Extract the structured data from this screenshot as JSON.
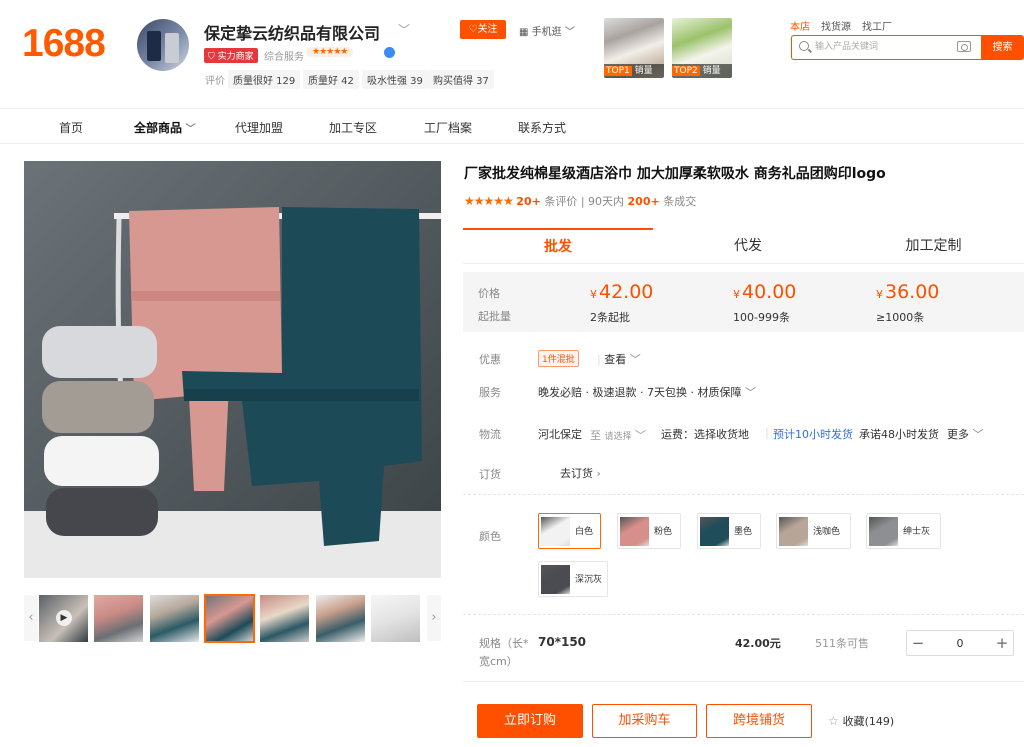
{
  "header": {
    "logo": "1688",
    "shop_name": "保定挚云纺织品有限公司",
    "badge_strength": "实力商家",
    "service_label": "综合服务",
    "service_stars": "★★★★★",
    "follow": "关注",
    "mobile_shop": "手机逛",
    "tags_label": "评价",
    "tags": [
      "质量很好 129",
      "质量好 42",
      "吸水性强 39",
      "购买值得 37"
    ],
    "top_images": [
      {
        "rank": "TOP1",
        "label": "销量"
      },
      {
        "rank": "TOP2",
        "label": "销量"
      }
    ],
    "top_links": [
      "本店",
      "找货源",
      "找工厂"
    ],
    "search_placeholder": "输入产品关键词",
    "search_button": "搜索"
  },
  "nav": {
    "items": [
      "首页",
      "全部商品",
      "代理加盟",
      "加工专区",
      "工厂档案",
      "联系方式"
    ],
    "active_index": 1
  },
  "product": {
    "title": "厂家批发纯棉星级酒店浴巾 加大加厚柔软吸水 商务礼品团购印logo",
    "rating_stars": "★★★★★",
    "reviews_count": "20+",
    "reviews_label": "条评价",
    "sold_prefix": "90天内",
    "sold_count": "200+",
    "sold_label": "条成交",
    "tabs": [
      "批发",
      "代发",
      "加工定制"
    ],
    "active_tab": 0
  },
  "pricing": {
    "price_label": "价格",
    "qty_label": "起批量",
    "currency": "¥",
    "tiers": [
      {
        "price": "42.00",
        "qty": "2条起批"
      },
      {
        "price": "40.00",
        "qty": "100-999条"
      },
      {
        "price": "36.00",
        "qty": "≥1000条"
      }
    ]
  },
  "offers": {
    "coupon_label": "优惠",
    "coupon_chip": "1件混批",
    "coupon_view": "查看",
    "service_label": "服务",
    "service_text": "晚发必赔 · 极速退款 · 7天包换 · 材质保障",
    "shipping_label": "物流",
    "ship_from": "河北保定",
    "ship_to_prefix": "至",
    "ship_to_placeholder": "请选择",
    "freight": "运费：选择收货地",
    "eta": "预计10小时发货",
    "promise": "承诺48小时发货",
    "more": "更多",
    "order_label": "订货",
    "order_link": "去订货"
  },
  "colors": {
    "label": "颜色",
    "options": [
      {
        "name": "白色",
        "color": "#f2f2f2"
      },
      {
        "name": "粉色",
        "color": "#d68f8a"
      },
      {
        "name": "墨色",
        "color": "#1f4d5a"
      },
      {
        "name": "浅咖色",
        "color": "#b7a597"
      },
      {
        "name": "绅士灰",
        "color": "#8e8f93"
      },
      {
        "name": "深沉灰",
        "color": "#4a4c52"
      }
    ],
    "selected_index": 0
  },
  "spec": {
    "label": "规格（长*宽cm）",
    "value": "70*150",
    "price": "42.00元",
    "stock": "511条可售",
    "quantity": "0"
  },
  "actions": {
    "order_now": "立即订购",
    "add_cart": "加采购车",
    "distribute": "跨境铺货",
    "favorite": "收藏(149)"
  }
}
